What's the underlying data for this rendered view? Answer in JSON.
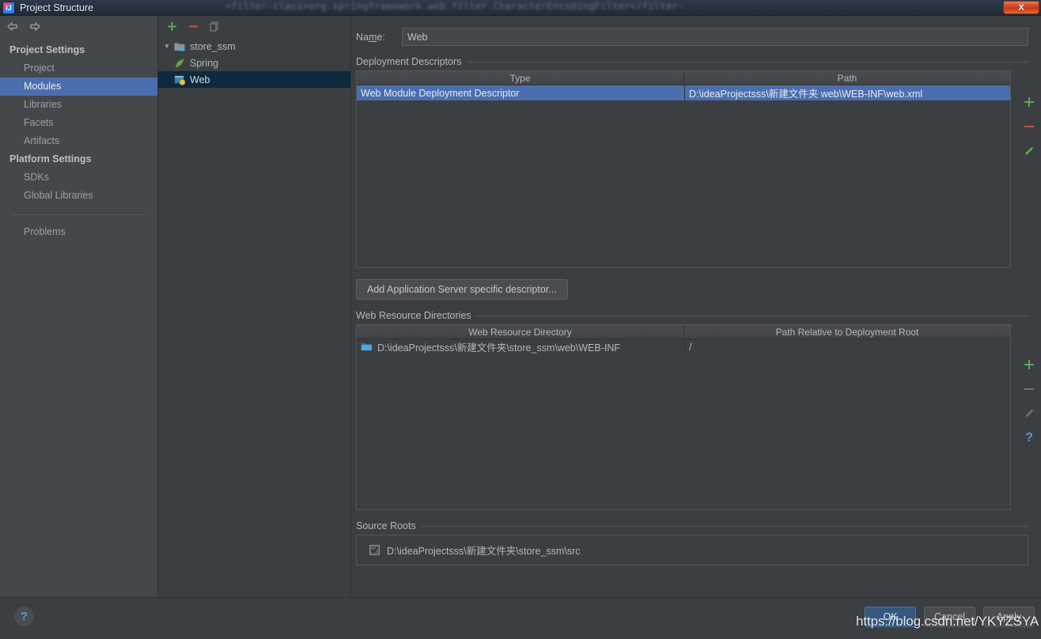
{
  "window": {
    "title": "Project Structure",
    "app_icon": "intellij-idea-icon",
    "close_label": "X",
    "background_text": "<filter-class>org.springframework.web.filter.CharacterEncodingFilter</filter-"
  },
  "sidebar": {
    "back_icon": "arrow-left-icon",
    "forward_icon": "arrow-right-icon",
    "groups": [
      {
        "label": "Project Settings",
        "items": [
          {
            "label": "Project",
            "selected": false
          },
          {
            "label": "Modules",
            "selected": true
          },
          {
            "label": "Libraries",
            "selected": false
          },
          {
            "label": "Facets",
            "selected": false
          },
          {
            "label": "Artifacts",
            "selected": false
          }
        ]
      },
      {
        "label": "Platform Settings",
        "items": [
          {
            "label": "SDKs",
            "selected": false
          },
          {
            "label": "Global Libraries",
            "selected": false
          }
        ]
      }
    ],
    "extra": {
      "label": "Problems"
    }
  },
  "tree": {
    "toolbar": [
      {
        "name": "add-module-button",
        "icon": "plus-icon"
      },
      {
        "name": "remove-module-button",
        "icon": "minus-icon"
      },
      {
        "name": "copy-module-button",
        "icon": "copy-icon"
      }
    ],
    "nodes": [
      {
        "label": "store_ssm",
        "icon": "module-folder-icon",
        "level": 0,
        "expanded": true,
        "selected": false
      },
      {
        "label": "Spring",
        "icon": "spring-leaf-icon",
        "level": 1,
        "selected": false
      },
      {
        "label": "Web",
        "icon": "web-facet-icon",
        "level": 1,
        "selected": true
      }
    ]
  },
  "content": {
    "name_field": {
      "label": "Name:",
      "label_prefix": "Na",
      "label_mnemonic": "m",
      "label_suffix": "e:",
      "value": "Web",
      "placeholder": ""
    },
    "deployment_descriptors": {
      "caption": "Deployment Descriptors",
      "columns": [
        "Type",
        "Path"
      ],
      "rows": [
        {
          "type": "Web Module Deployment Descriptor",
          "path": "D:\\ideaProjectsss\\新建文件夹            web\\WEB-INF\\web.xml",
          "path_visible_head": "D:\\ideaProjectsss\\新建文件夹",
          "path_visible_tail": "web\\WEB-INF\\web.xml",
          "selected": true
        }
      ],
      "toolbar": [
        {
          "name": "add-descriptor-button",
          "icon": "plus-icon"
        },
        {
          "name": "remove-descriptor-button",
          "icon": "minus-icon"
        },
        {
          "name": "edit-descriptor-button",
          "icon": "pencil-icon"
        }
      ],
      "add_button_label": "Add Application Server specific descriptor..."
    },
    "web_resource_directories": {
      "caption": "Web Resource Directories",
      "columns": [
        "Web Resource Directory",
        "Path Relative to Deployment Root"
      ],
      "rows": [
        {
          "directory": "D:\\ideaProjectsss\\新建文件夹\\store_ssm\\web\\WEB-INF",
          "relative_path": "/",
          "icon": "folder-icon"
        }
      ],
      "toolbar": [
        {
          "name": "add-web-resource-button",
          "icon": "plus-icon"
        },
        {
          "name": "remove-web-resource-button",
          "icon": "minus-icon"
        },
        {
          "name": "edit-web-resource-button",
          "icon": "pencil-icon"
        },
        {
          "name": "help-web-resource-button",
          "icon": "question-icon"
        }
      ]
    },
    "source_roots": {
      "caption": "Source Roots",
      "items": [
        {
          "label": "D:\\ideaProjectsss\\新建文件夹\\store_ssm\\src",
          "checked": true
        }
      ]
    }
  },
  "footer": {
    "help_icon": "question-icon",
    "buttons": [
      {
        "label": "OK",
        "primary": true
      },
      {
        "label": "Cancel",
        "primary": false
      },
      {
        "label": "Apply",
        "primary": false
      }
    ]
  },
  "watermark": {
    "text": "https://blog.csdn.net/YKYZSYA"
  }
}
